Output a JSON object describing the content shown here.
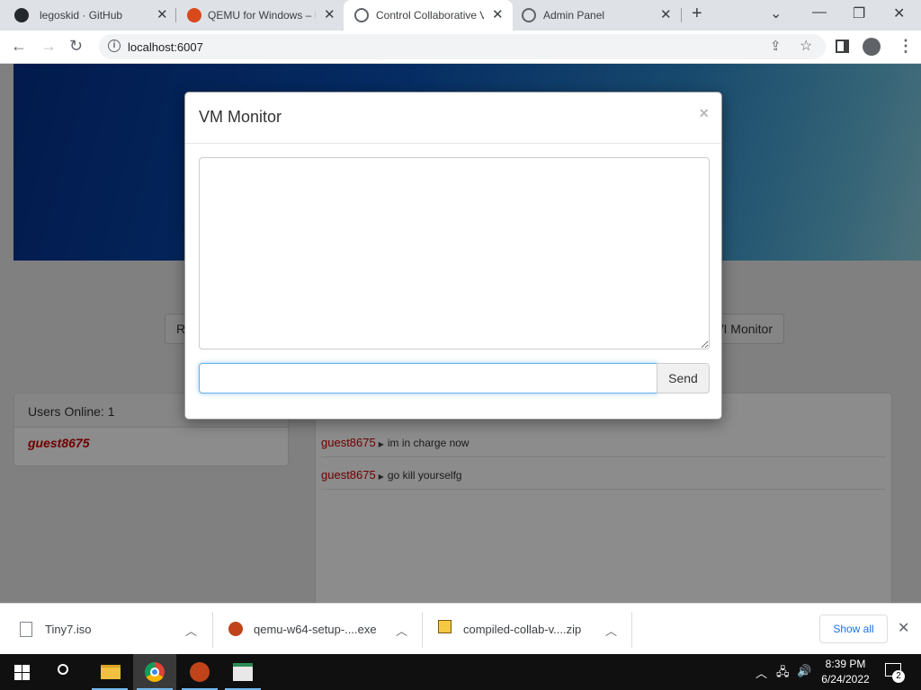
{
  "browser": {
    "tabs": [
      {
        "label": "legoskid · GitHub",
        "active": false
      },
      {
        "label": "QEMU for Windows – I",
        "active": false
      },
      {
        "label": "Control Collaborative V",
        "active": true
      },
      {
        "label": "Admin Panel",
        "active": false
      }
    ],
    "new_tab_glyph": "+",
    "url": "localhost:6007"
  },
  "page": {
    "left_button_label": "R",
    "right_button_label": "/I Monitor",
    "users_online_label": "Users Online: 1",
    "online_users": [
      "guest8675"
    ],
    "chat_messages": [
      {
        "user": "guest8675",
        "text": "im in charge now"
      },
      {
        "user": "guest8675",
        "text": "go kill yourselfg"
      }
    ]
  },
  "modal": {
    "title": "VM Monitor",
    "close_glyph": "×",
    "monitor_output": "",
    "command_input_value": "",
    "send_label": "Send"
  },
  "downloads": {
    "items": [
      {
        "name": "Tiny7.iso",
        "icon": "file-icon"
      },
      {
        "name": "qemu-w64-setup-....exe",
        "icon": "qemu-icon"
      },
      {
        "name": "compiled-collab-v....zip",
        "icon": "zip-icon"
      }
    ],
    "show_all_label": "Show all"
  },
  "taskbar": {
    "time": "8:39 PM",
    "date": "6/24/2022",
    "notification_count": "2"
  },
  "colors": {
    "username": "#cc0000",
    "accent": "#1a73e8",
    "focus_ring": "#66afe9"
  }
}
